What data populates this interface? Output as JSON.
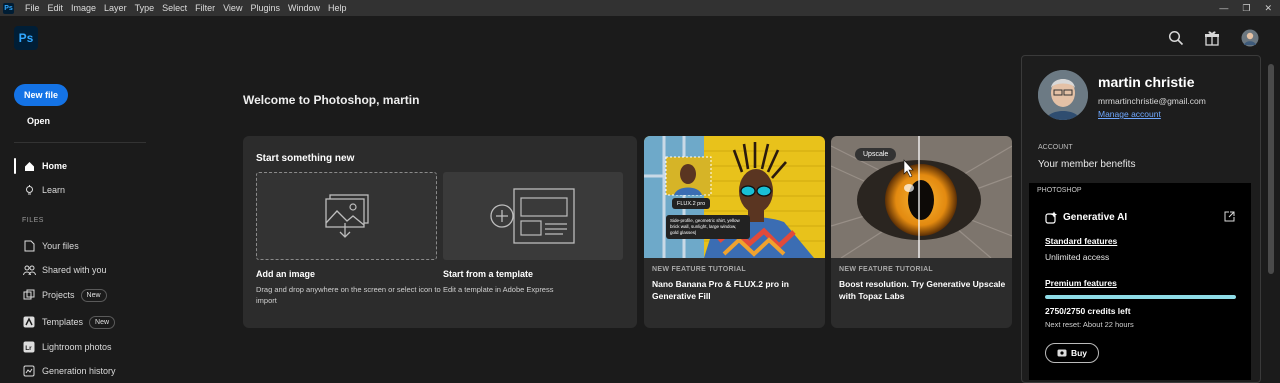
{
  "menubar": {
    "app_icon": "Ps",
    "items": [
      "File",
      "Edit",
      "Image",
      "Layer",
      "Type",
      "Select",
      "Filter",
      "View",
      "Plugins",
      "Window",
      "Help"
    ],
    "window_controls": [
      "minimize-icon",
      "restore-icon",
      "close-icon"
    ]
  },
  "header": {
    "logo_text": "Ps",
    "icons": [
      "search-icon",
      "gift-icon",
      "avatar"
    ]
  },
  "sidebar": {
    "new_file": "New file",
    "open": "Open",
    "nav": [
      {
        "label": "Home",
        "icon": "home-icon",
        "active": true
      },
      {
        "label": "Learn",
        "icon": "lightbulb-icon"
      }
    ],
    "files_header": "FILES",
    "files": [
      {
        "label": "Your files",
        "icon": "file-icon"
      },
      {
        "label": "Shared with you",
        "icon": "people-icon"
      },
      {
        "label": "Projects",
        "icon": "projects-icon",
        "badge": "New"
      },
      {
        "label": "Templates",
        "icon": "templates-icon",
        "badge": "New"
      },
      {
        "label": "Lightroom photos",
        "icon": "lightroom-icon"
      },
      {
        "label": "Generation history",
        "icon": "history-icon"
      }
    ]
  },
  "main": {
    "welcome": "Welcome to Photoshop, martin",
    "start": {
      "title": "Start something new",
      "add_image": {
        "title": "Add an image",
        "desc": "Drag and drop anywhere on the screen or select icon to import"
      },
      "template": {
        "title": "Start from a template",
        "desc": "Edit a template in Adobe Express"
      }
    },
    "features": [
      {
        "kicker": "NEW FEATURE TUTORIAL",
        "title": "Nano Banana Pro & FLUX.2 pro in Generative Fill",
        "chip": "FLUX.2 pro",
        "prompt": "Side-profile, geometric shirt, yellow brick wall, sunlight, large window, gold glasses|"
      },
      {
        "kicker": "NEW FEATURE TUTORIAL",
        "title": "Boost resolution. Try Generative Upscale with Topaz Labs",
        "chip": "Upscale"
      }
    ]
  },
  "account": {
    "name": "martin christie",
    "email": "mrmartinchristie@gmail.com",
    "manage": "Manage account",
    "account_label": "ACCOUNT",
    "benefits": "Your member benefits",
    "ps_label": "PHOTOSHOP",
    "gen_ai": "Generative AI",
    "standard": "Standard features",
    "unlimited": "Unlimited access",
    "premium": "Premium features",
    "credits_fraction": 1.0,
    "credits": "2750/2750 credits left",
    "reset": "Next reset: About 22 hours",
    "buy": "Buy",
    "accent_color": "#8fdde8"
  }
}
